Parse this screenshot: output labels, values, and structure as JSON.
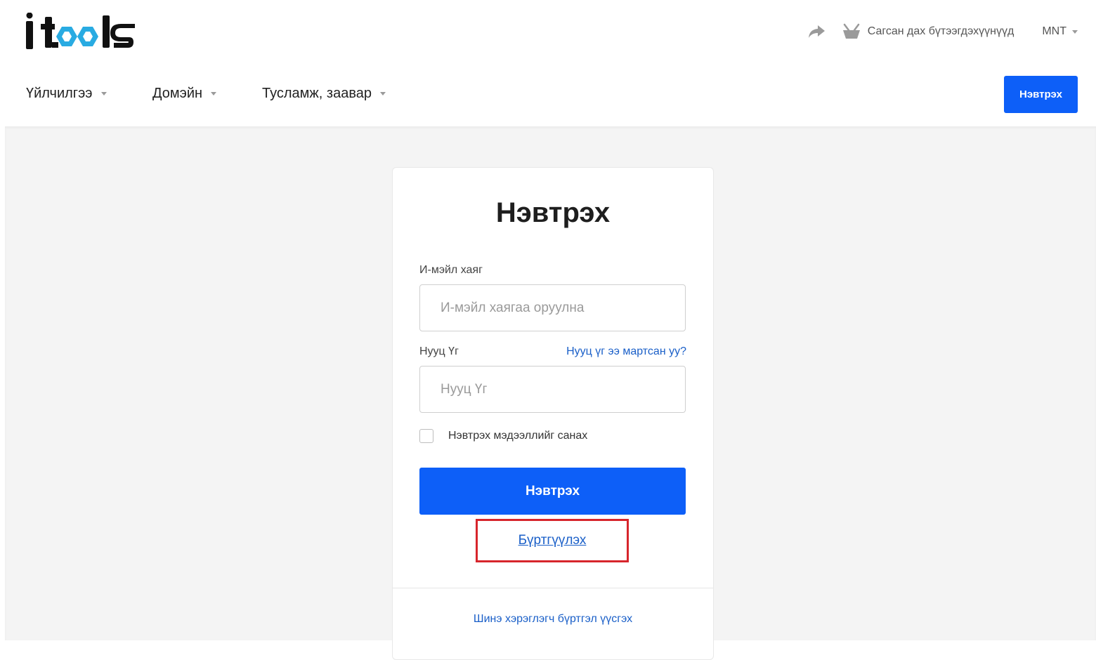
{
  "header": {
    "logo_text": "itools",
    "cart_label": "Сагсан дах бүтээгдэхүүнүүд",
    "currency": "MNT",
    "login_button": "Нэвтрэх"
  },
  "nav": {
    "items": [
      {
        "label": "Үйлчилгээ"
      },
      {
        "label": "Домэйн"
      },
      {
        "label": "Тусламж, заавар"
      }
    ]
  },
  "login_form": {
    "title": "Нэвтрэх",
    "email_label": "И-мэйл хаяг",
    "email_placeholder": "И-мэйл хаягаа оруулна",
    "email_value": "",
    "password_label": "Нууц Үг",
    "password_placeholder": "Нууц Үг",
    "password_value": "",
    "forgot_password": "Нууц үг ээ мартсан уу?",
    "remember_me": "Нэвтрэх мэдээллийг санах",
    "remember_checked": false,
    "submit_label": "Нэвтрэх",
    "register_link": "Бүртгүүлэх",
    "new_user_link": "Шинэ хэрэглэгч бүртгэл үүсгэх"
  },
  "colors": {
    "primary": "#0d5ff8",
    "link": "#1a5fc8",
    "highlight": "#d7252c",
    "logo_accent": "#29abe2"
  }
}
